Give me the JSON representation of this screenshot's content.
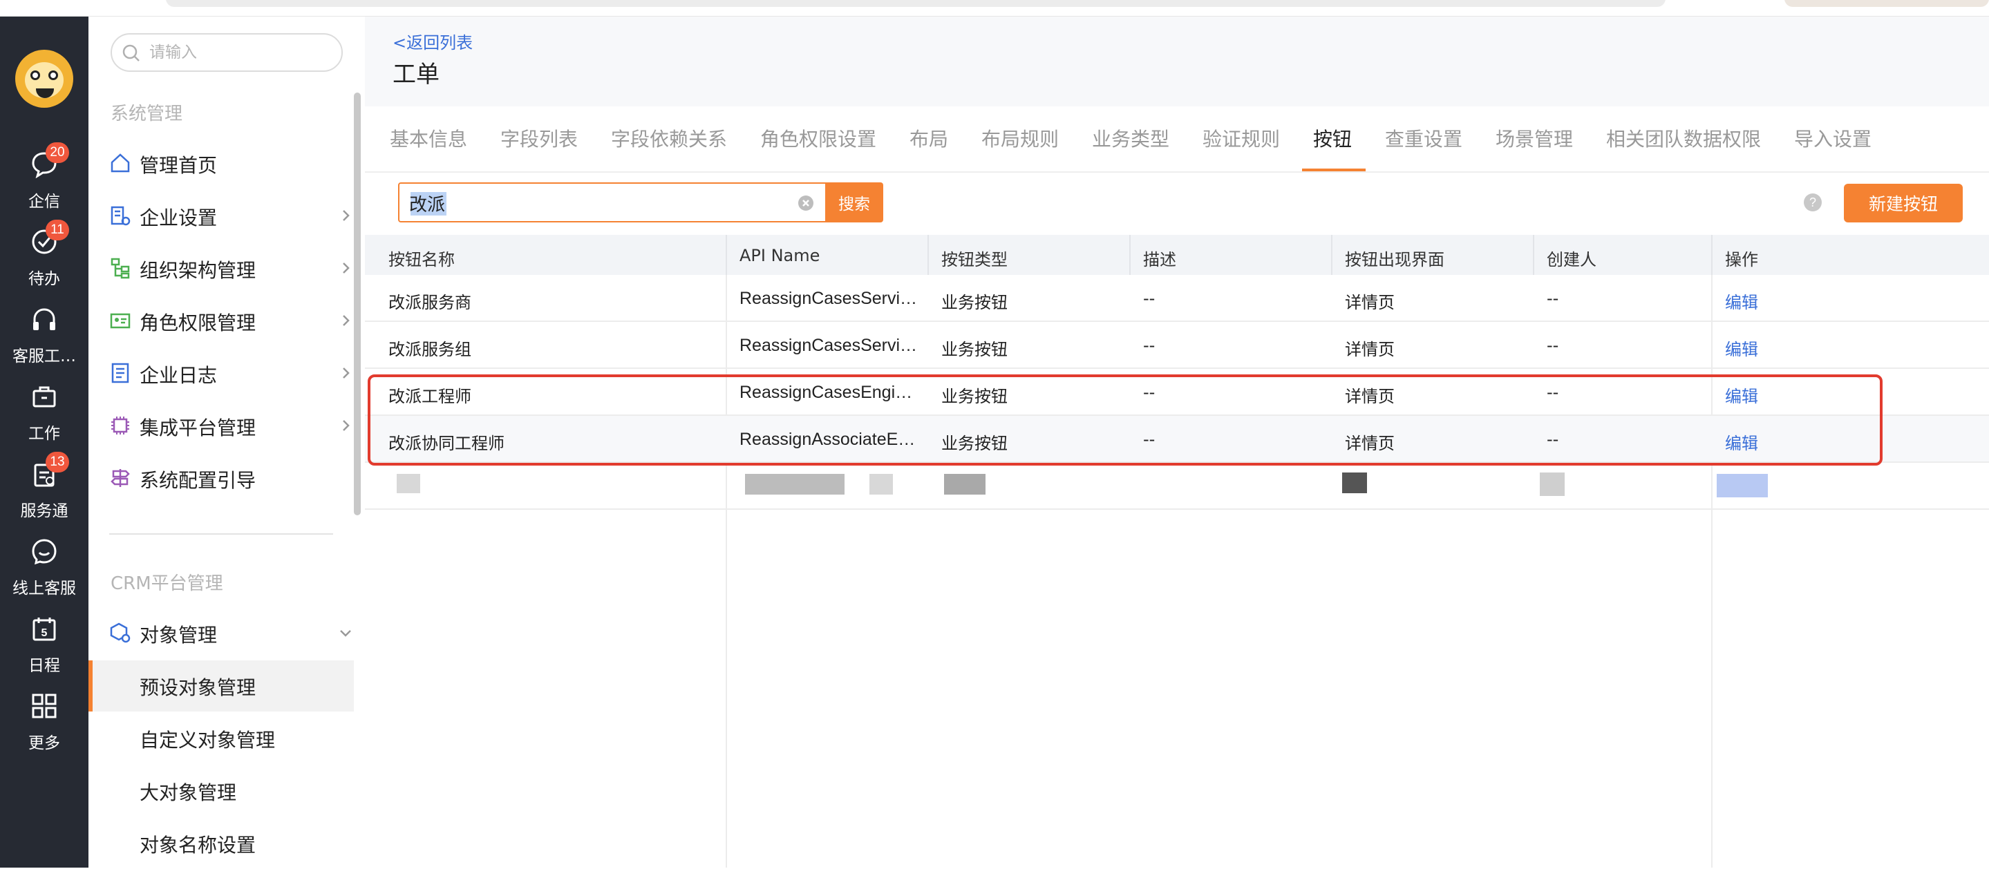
{
  "rail": {
    "items": [
      {
        "label": "企信",
        "badge": "20",
        "icon": "chat-bubble-icon"
      },
      {
        "label": "待办",
        "badge": "11",
        "icon": "check-circle-icon"
      },
      {
        "label": "客服工…",
        "badge": "",
        "icon": "headset-icon"
      },
      {
        "label": "工作",
        "badge": "",
        "icon": "briefcase-icon"
      },
      {
        "label": "服务通",
        "badge": "13",
        "icon": "clipboard-icon"
      },
      {
        "label": "线上客服",
        "badge": "",
        "icon": "smile-chat-icon"
      },
      {
        "label": "日程",
        "badge": "",
        "icon": "calendar-icon",
        "day": "5"
      },
      {
        "label": "更多",
        "badge": "",
        "icon": "grid-icon"
      }
    ]
  },
  "sidebar": {
    "search_placeholder": "请输入",
    "section1": "系统管理",
    "items": [
      {
        "label": "管理首页",
        "icon": "home-icon"
      },
      {
        "label": "企业设置",
        "icon": "building-icon"
      },
      {
        "label": "组织架构管理",
        "icon": "org-chart-icon"
      },
      {
        "label": "角色权限管理",
        "icon": "id-card-icon"
      },
      {
        "label": "企业日志",
        "icon": "log-icon"
      },
      {
        "label": "集成平台管理",
        "icon": "chip-icon"
      },
      {
        "label": "系统配置引导",
        "icon": "signpost-icon"
      }
    ],
    "section2": "CRM平台管理",
    "object_mgmt": "对象管理",
    "sub_items": [
      "预设对象管理",
      "自定义对象管理",
      "大对象管理",
      "对象名称设置"
    ]
  },
  "header": {
    "back": "<返回列表",
    "title": "工单"
  },
  "tabs": [
    "基本信息",
    "字段列表",
    "字段依赖关系",
    "角色权限设置",
    "布局",
    "布局规则",
    "业务类型",
    "验证规则",
    "按钮",
    "查重设置",
    "场景管理",
    "相关团队数据权限",
    "导入设置"
  ],
  "active_tab": "按钮",
  "toolbar": {
    "search_value": "改派",
    "search_button": "搜索",
    "help": "?",
    "new_button": "新建按钮"
  },
  "table": {
    "columns": [
      "按钮名称",
      "API Name",
      "按钮类型",
      "描述",
      "按钮出现界面",
      "创建人",
      "操作"
    ],
    "rows": [
      [
        "改派服务商",
        "ReassignCasesServi…",
        "业务按钮",
        "--",
        "详情页",
        "--",
        "编辑"
      ],
      [
        "改派服务组",
        "ReassignCasesServi…",
        "业务按钮",
        "--",
        "详情页",
        "--",
        "编辑"
      ],
      [
        "改派工程师",
        "ReassignCasesEngin…",
        "业务按钮",
        "--",
        "详情页",
        "--",
        "编辑"
      ],
      [
        "改派协同工程师",
        "ReassignAssociateE…",
        "业务按钮",
        "--",
        "详情页",
        "--",
        "编辑"
      ]
    ]
  },
  "colors": {
    "accent": "#f58232",
    "link": "#3a6fd8",
    "rail": "#262a33",
    "badge": "#f0573d",
    "highlight_box": "#e23b2e"
  }
}
